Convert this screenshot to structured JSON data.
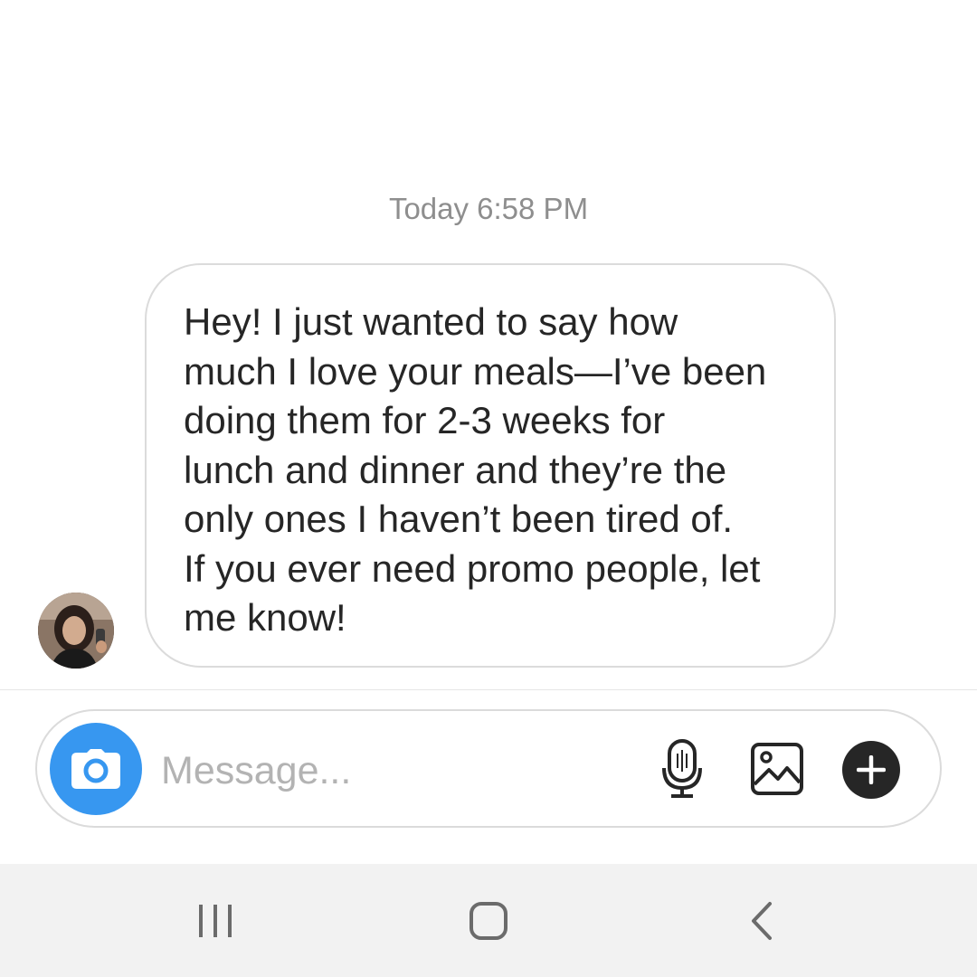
{
  "thread": {
    "timestamp": "Today 6:58 PM",
    "message": {
      "sender_avatar": "user-avatar-photo",
      "text": "Hey! I just wanted to say how\nmuch I love your meals—I’ve been\ndoing them for 2-3 weeks for\nlunch and dinner and they’re the\nonly ones I haven’t been tired of.\nIf you ever need promo people, let\nme know!"
    }
  },
  "composer": {
    "placeholder": "Message...",
    "value": "",
    "camera_icon": "camera-icon",
    "mic_icon": "microphone-icon",
    "gallery_icon": "image-gallery-icon",
    "plus_icon": "plus-icon",
    "accent_color": "#3797f0"
  },
  "system_nav": {
    "recent_icon": "recent-apps-icon",
    "home_icon": "home-icon",
    "back_icon": "back-icon"
  }
}
